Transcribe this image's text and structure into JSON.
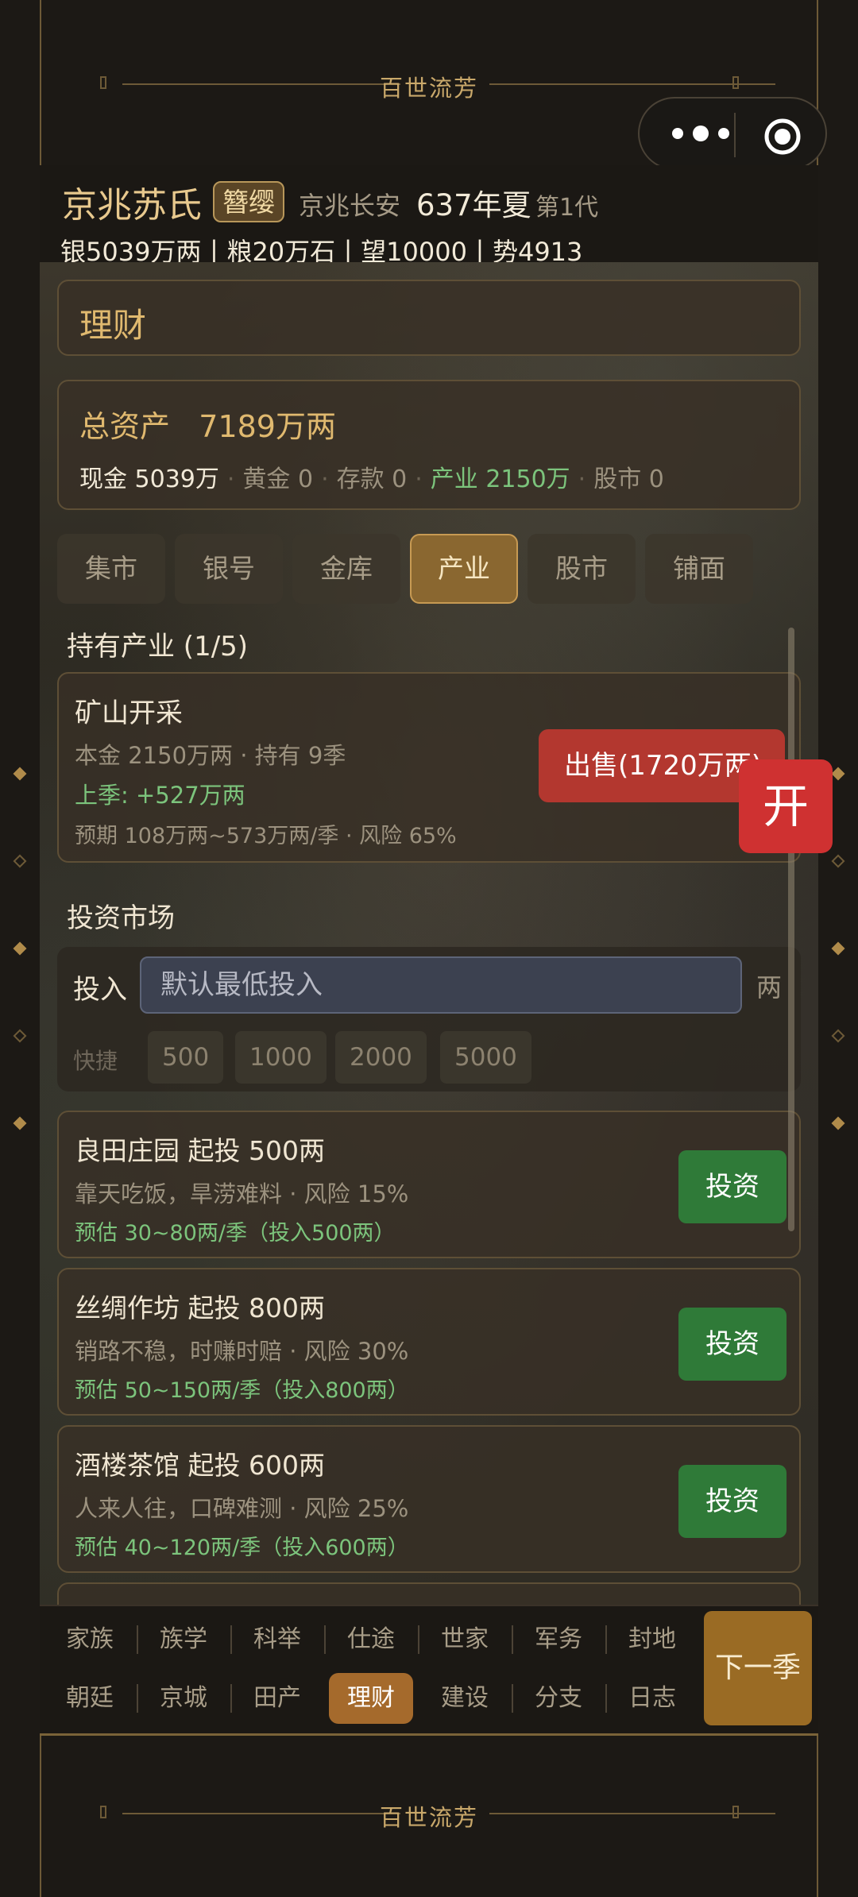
{
  "app": {
    "title": "百世流芳"
  },
  "header": {
    "family": "京兆苏氏",
    "badge": "簪缨",
    "location": "京兆长安",
    "year": "637年夏",
    "generation": "第1代",
    "stats": "银5039万两丨粮20万石丨望10000丨势4913"
  },
  "page": {
    "title": "理财"
  },
  "assets": {
    "title": "总资产",
    "total": "7189万两",
    "cash": "现金 5039万",
    "gold": "黄金 0",
    "deposit": "存款 0",
    "industry": "产业 2150万",
    "stock": "股市 0"
  },
  "tabs": [
    "集市",
    "银号",
    "金库",
    "产业",
    "股市",
    "铺面"
  ],
  "active_tab": "产业",
  "holdings": {
    "title": "持有产业 (1/5)",
    "items": [
      {
        "name": "矿山开采",
        "line1": "本金 2150万两 · 持有 9季",
        "line2": "上季: +527万两",
        "line3": "预期 108万两~573万两/季 · 风险 65%",
        "sell": "出售(1720万两)"
      }
    ]
  },
  "floating": {
    "open": "开"
  },
  "market": {
    "title": "投资市场",
    "input_label": "投入",
    "input_placeholder": "默认最低投入",
    "unit": "两",
    "quick_label": "快捷",
    "quick": [
      "500",
      "1000",
      "2000",
      "5000"
    ]
  },
  "cards": [
    {
      "name": "良田庄园  起投 500两",
      "desc": "靠天吃饭，旱涝难料 · 风险 15%",
      "est": "预估 30~80两/季（投入500两）",
      "btn": "投资"
    },
    {
      "name": "丝绸作坊  起投 800两",
      "desc": "销路不稳，时赚时赔 · 风险 30%",
      "est": "预估 50~150两/季（投入800两）",
      "btn": "投资"
    },
    {
      "name": "酒楼茶馆  起投 600两",
      "desc": "人来人往，口碑难测 · 风险 25%",
      "est": "预估 40~120两/季（投入600两）",
      "btn": "投资"
    }
  ],
  "nav": {
    "row1": [
      "家族",
      "族学",
      "科举",
      "仕途",
      "世家",
      "军务",
      "封地"
    ],
    "row2": [
      "朝廷",
      "京城",
      "田产",
      "理财",
      "建设",
      "分支",
      "日志"
    ],
    "active": "理财",
    "next": "下一季"
  },
  "colors": {
    "accent": "#e0b96f",
    "positive": "#7cc47c",
    "sell": "#b3372f",
    "invest": "#2f7a38",
    "active_tab": "#8a6730"
  }
}
